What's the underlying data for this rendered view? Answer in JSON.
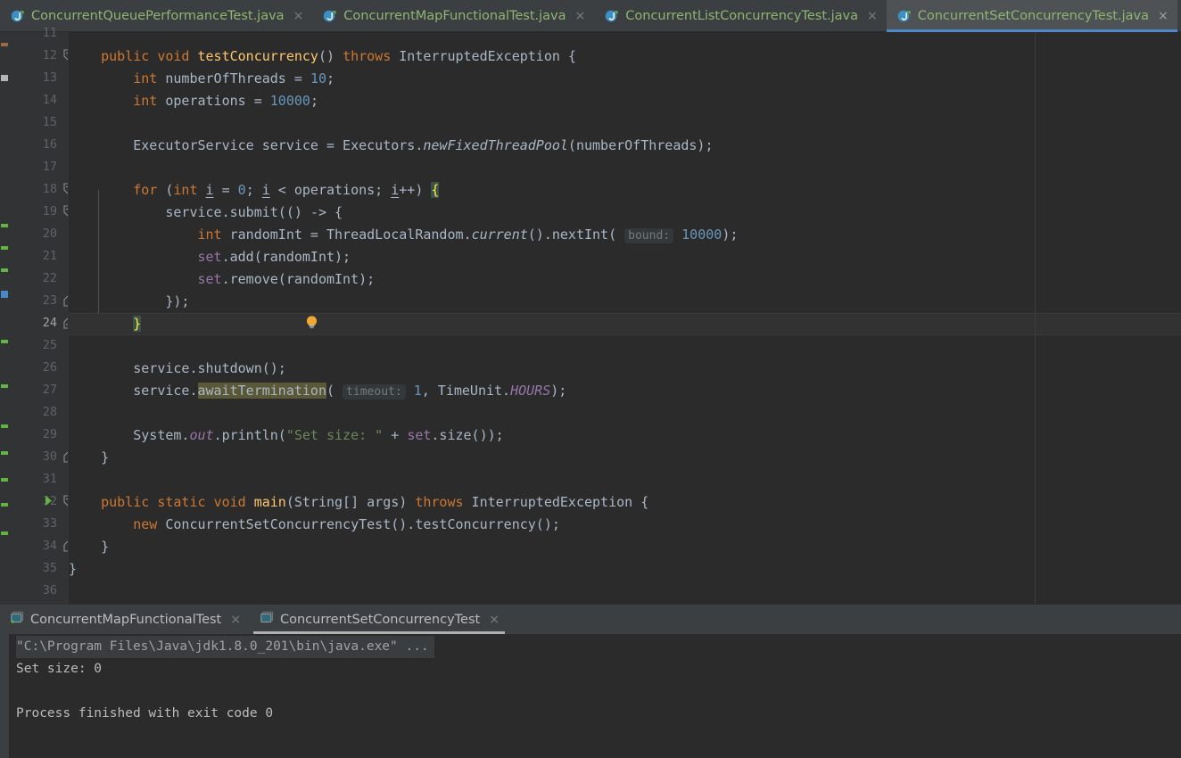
{
  "window": {
    "app": "IntelliJ IDEA",
    "theme_bg": "#2b2b2b",
    "accent": "#4a88c7"
  },
  "editor_tabs": [
    {
      "label": "ConcurrentQueuePerformanceTest.java",
      "icon": "java-class-run-icon",
      "close": "×",
      "active": false
    },
    {
      "label": "ConcurrentMapFunctionalTest.java",
      "icon": "java-class-run-icon",
      "close": "×",
      "active": false
    },
    {
      "label": "ConcurrentListConcurrencyTest.java",
      "icon": "java-class-run-icon",
      "close": "×",
      "active": false
    },
    {
      "label": "ConcurrentSetConcurrencyTest.java",
      "icon": "java-class-run-icon",
      "close": "×",
      "active": true
    }
  ],
  "gutter": {
    "first_visible_line": 11,
    "last_visible_line": 36,
    "caret_line": 24,
    "line_numbers": [
      11,
      12,
      13,
      14,
      15,
      16,
      17,
      18,
      19,
      20,
      21,
      22,
      23,
      24,
      25,
      26,
      27,
      28,
      29,
      30,
      31,
      32,
      33,
      34,
      35,
      36
    ],
    "run_marker_line": 32,
    "fold_open_lines": [
      12,
      18,
      19,
      32
    ],
    "fold_close_lines": [
      23,
      24,
      30,
      34
    ]
  },
  "code": {
    "inlay_hints": [
      "bound:",
      "timeout:"
    ],
    "highlighted_identifier": "awaitTermination",
    "lines": [
      {
        "n": 12,
        "text": "    public void testConcurrency() throws InterruptedException {"
      },
      {
        "n": 13,
        "text": "        int numberOfThreads = 10;"
      },
      {
        "n": 14,
        "text": "        int operations = 10000;"
      },
      {
        "n": 15,
        "text": ""
      },
      {
        "n": 16,
        "text": "        ExecutorService service = Executors.newFixedThreadPool(numberOfThreads);"
      },
      {
        "n": 17,
        "text": ""
      },
      {
        "n": 18,
        "text": "        for (int i = 0; i < operations; i++) {"
      },
      {
        "n": 19,
        "text": "            service.submit(() -> {"
      },
      {
        "n": 20,
        "text": "                int randomInt = ThreadLocalRandom.current().nextInt( bound: 10000);"
      },
      {
        "n": 21,
        "text": "                set.add(randomInt);"
      },
      {
        "n": 22,
        "text": "                set.remove(randomInt);"
      },
      {
        "n": 23,
        "text": "            });"
      },
      {
        "n": 24,
        "text": "        }"
      },
      {
        "n": 25,
        "text": ""
      },
      {
        "n": 26,
        "text": "        service.shutdown();"
      },
      {
        "n": 27,
        "text": "        service.awaitTermination( timeout: 1, TimeUnit.HOURS);"
      },
      {
        "n": 28,
        "text": ""
      },
      {
        "n": 29,
        "text": "        System.out.println(\"Set size: \" + set.size());"
      },
      {
        "n": 30,
        "text": "    }"
      },
      {
        "n": 31,
        "text": ""
      },
      {
        "n": 32,
        "text": "    public static void main(String[] args) throws InterruptedException {"
      },
      {
        "n": 33,
        "text": "        new ConcurrentSetConcurrencyTest().testConcurrency();"
      },
      {
        "n": 34,
        "text": "    }"
      },
      {
        "n": 35,
        "text": "}"
      },
      {
        "n": 36,
        "text": ""
      }
    ],
    "tokens": {
      "l12": {
        "kw1": "public",
        "kw2": "void",
        "method": "testConcurrency",
        "parens": "()",
        "kw3": "throws",
        "type": "InterruptedException",
        "brace": "{"
      },
      "l13": {
        "kw": "int",
        "name": " numberOfThreads = ",
        "num": "10",
        "semi": ";"
      },
      "l14": {
        "kw": "int",
        "name": " operations = ",
        "num": "10000",
        "semi": ";"
      },
      "l16": {
        "type": "ExecutorService service = Executors.",
        "static": "newFixedThreadPool",
        "args": "(numberOfThreads);"
      },
      "l18": {
        "kw": "for",
        "open": " (",
        "kw2": "int",
        "v1": "i",
        "eq": " = ",
        "num": "0",
        "semi1": "; ",
        "v2": "i",
        "lt": " < operations; ",
        "v3": "i",
        "inc": "++) ",
        "brace": "{"
      },
      "l19": {
        "text": "service.submit(() -> {"
      },
      "l20": {
        "kw": "int",
        "mid": " randomInt = ThreadLocalRandom.",
        "static": "current",
        "call": "().nextInt(",
        "hint": "bound:",
        "num": "10000",
        "end": ");"
      },
      "l21": {
        "field": "set",
        "rest": ".add(randomInt);"
      },
      "l22": {
        "field": "set",
        "rest": ".remove(randomInt);"
      },
      "l23": {
        "text": "});"
      },
      "l24": {
        "brace": "}"
      },
      "l26": {
        "text": "service.shutdown();"
      },
      "l27": {
        "pre": "service.",
        "hl": "awaitTermination",
        "open": "(",
        "hint": "timeout:",
        "num": "1",
        "mid": ", TimeUnit.",
        "field": "HOURS",
        "end": ");"
      },
      "l29": {
        "pre": "System.",
        "field": "out",
        "mid": ".println(",
        "str": "\"Set size: \"",
        "plus": " + ",
        "field2": "set",
        "end": ".size());"
      },
      "l30": {
        "brace": "}"
      },
      "l32": {
        "kw1": "public",
        "kw2": "static",
        "kw3": "void",
        "method": "main",
        "args": "(String[] args) ",
        "kw4": "throws",
        "type": " InterruptedException ",
        "brace": "{"
      },
      "l33": {
        "kw": "new",
        "rest": " ConcurrentSetConcurrencyTest().testConcurrency();"
      },
      "l34": {
        "brace": "}"
      },
      "l35": {
        "brace": "}"
      }
    }
  },
  "intention_bulb": {
    "name": "intention-action-lightbulb",
    "color": "#f0a732"
  },
  "console_tabs": [
    {
      "label": "ConcurrentMapFunctionalTest",
      "icon": "console-window-icon",
      "close": "×",
      "active": false
    },
    {
      "label": "ConcurrentSetConcurrencyTest",
      "icon": "console-window-icon",
      "close": "×",
      "active": true
    }
  ],
  "console_output": [
    {
      "text": "\"C:\\Program Files\\Java\\jdk1.8.0_201\\bin\\java.exe\" ...",
      "kind": "command"
    },
    {
      "text": "Set size: 0",
      "kind": "stdout"
    },
    {
      "text": "",
      "kind": "blank"
    },
    {
      "text": "Process finished with exit code 0",
      "kind": "stdout"
    }
  ],
  "syntax_colors": {
    "keyword": "#cc7832",
    "method": "#ffc66d",
    "number": "#6897bb",
    "string": "#6a8759",
    "field": "#9876aa",
    "default": "#a9b7c6",
    "comment": "#808080",
    "inlay_hint": "#787878"
  }
}
